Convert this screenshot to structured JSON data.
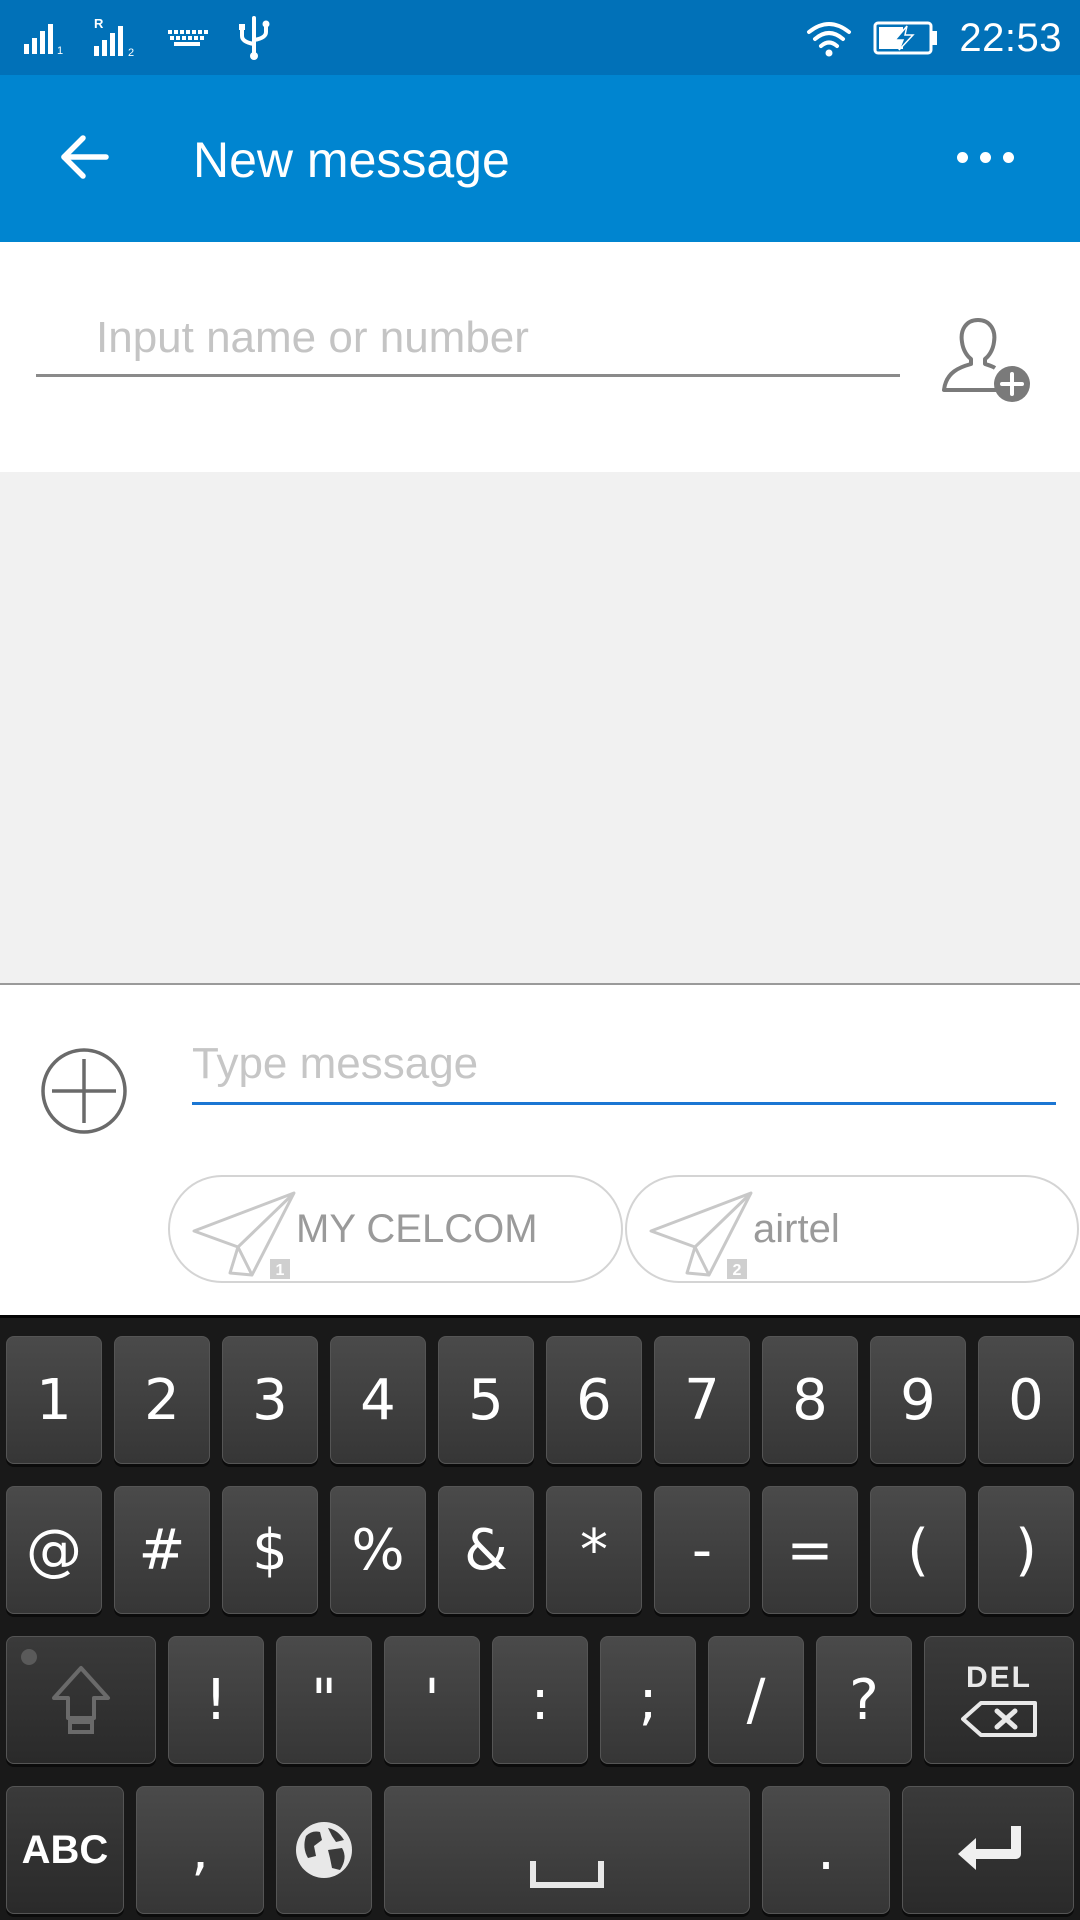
{
  "status_bar": {
    "time": "22:53",
    "icons": [
      "signal-sim1-icon",
      "signal-sim2-roaming-icon",
      "keyboard-icon",
      "usb-icon",
      "wifi-icon",
      "battery-charging-icon"
    ]
  },
  "app_bar": {
    "title": "New message",
    "back_icon": "arrow-left-icon",
    "more_icon": "more-horizontal-icon"
  },
  "recipient": {
    "placeholder": "Input name or number",
    "add_contact_icon": "add-contact-icon"
  },
  "compose": {
    "placeholder": "Type message",
    "attach_icon": "plus-circle-icon",
    "send_buttons": [
      {
        "label": "MY CELCOM",
        "sim": "1"
      },
      {
        "label": "airtel",
        "sim": "2"
      }
    ]
  },
  "keyboard": {
    "row1": [
      "1",
      "2",
      "3",
      "4",
      "5",
      "6",
      "7",
      "8",
      "9",
      "0"
    ],
    "row2": [
      "@",
      "#",
      "$",
      "%",
      "&",
      "*",
      "-",
      "=",
      "(",
      ")"
    ],
    "row3": [
      "!",
      "\"",
      "'",
      ":",
      ";",
      "/",
      "?"
    ],
    "del_label": "DEL",
    "abc_label": "ABC",
    "comma": ",",
    "period": ".",
    "shift_icon": "shift-icon",
    "globe_icon": "globe-icon",
    "space_icon": "space-icon",
    "enter_icon": "enter-icon"
  },
  "colors": {
    "status_bar": "#0171b8",
    "app_bar": "#0085d0",
    "accent_line": "#1b76d3",
    "conversation_bg": "#f1f1f1",
    "keyboard_bg": "#191919"
  }
}
